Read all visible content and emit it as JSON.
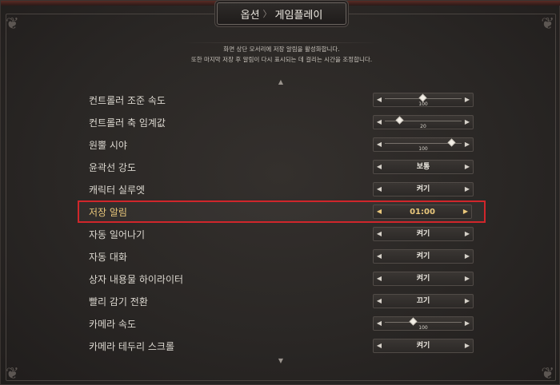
{
  "header": {
    "breadcrumb_root": "옵션",
    "breadcrumb_separator": "〉",
    "breadcrumb_current": "게임플레이"
  },
  "description": {
    "line1": "화면 상단 모서리에 저장 알림을 활성화합니다.",
    "line2": "또한 마지막 저장 후 알림이 다시 표시되는 데 걸리는 시간을 조정합니다."
  },
  "scroll": {
    "up_icon": "caret-up-icon",
    "down_icon": "caret-down-icon"
  },
  "colors": {
    "selection_border": "#d0262b",
    "selected_text": "#e9c77b",
    "text": "#dcd8d0"
  },
  "settings": [
    {
      "label": "컨트롤러 조준 속도",
      "type": "slider",
      "value": "100",
      "level": 0.5
    },
    {
      "label": "컨트롤러 축 임계값",
      "type": "slider",
      "value": "20",
      "level": 0.2
    },
    {
      "label": "원뿔 시야",
      "type": "slider",
      "value": "100",
      "level": 0.87
    },
    {
      "label": "윤곽선 강도",
      "type": "choice",
      "value": "보통"
    },
    {
      "label": "캐릭터 실루엣",
      "type": "choice",
      "value": "켜기"
    },
    {
      "label": "저장 알림",
      "type": "choice",
      "value": "01:00",
      "selected": true
    },
    {
      "label": "자동 일어나기",
      "type": "choice",
      "value": "켜기"
    },
    {
      "label": "자동 대화",
      "type": "choice",
      "value": "켜기"
    },
    {
      "label": "상자 내용물 하이라이터",
      "type": "choice",
      "value": "켜기"
    },
    {
      "label": "빨리 감기 전환",
      "type": "choice",
      "value": "끄기"
    },
    {
      "label": "카메라 속도",
      "type": "slider",
      "value": "100",
      "level": 0.37
    },
    {
      "label": "카메라 테두리 스크롤",
      "type": "choice",
      "value": "켜기"
    }
  ]
}
